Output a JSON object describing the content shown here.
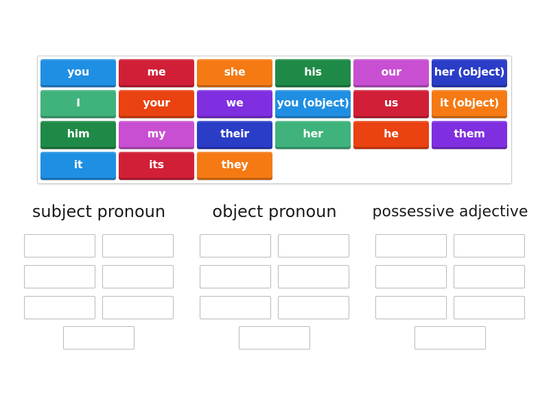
{
  "tiles": [
    {
      "label": "you",
      "color": "#1f8fe3"
    },
    {
      "label": "me",
      "color": "#d11f37"
    },
    {
      "label": "she",
      "color": "#f57a14"
    },
    {
      "label": "his",
      "color": "#1f8a47"
    },
    {
      "label": "our",
      "color": "#c84fd1"
    },
    {
      "label": "her (object)",
      "color": "#2a3dc7"
    },
    {
      "label": "I",
      "color": "#3fb37b"
    },
    {
      "label": "your",
      "color": "#ea4210"
    },
    {
      "label": "we",
      "color": "#7f2fe0"
    },
    {
      "label": "you (object)",
      "color": "#1f8fe3"
    },
    {
      "label": "us",
      "color": "#d11f37"
    },
    {
      "label": "it (object)",
      "color": "#f57a14"
    },
    {
      "label": "him",
      "color": "#1f8a47"
    },
    {
      "label": "my",
      "color": "#c84fd1"
    },
    {
      "label": "their",
      "color": "#2a3dc7"
    },
    {
      "label": "her",
      "color": "#3fb37b"
    },
    {
      "label": "he",
      "color": "#ea4210"
    },
    {
      "label": "them",
      "color": "#7f2fe0"
    },
    {
      "label": "it",
      "color": "#1f8fe3"
    },
    {
      "label": "its",
      "color": "#d11f37"
    },
    {
      "label": "they",
      "color": "#f57a14"
    }
  ],
  "groups": [
    {
      "title": "subject pronoun",
      "slots": 7
    },
    {
      "title": "object pronoun",
      "slots": 7
    },
    {
      "title": "possessive adjective",
      "slots": 7
    }
  ]
}
